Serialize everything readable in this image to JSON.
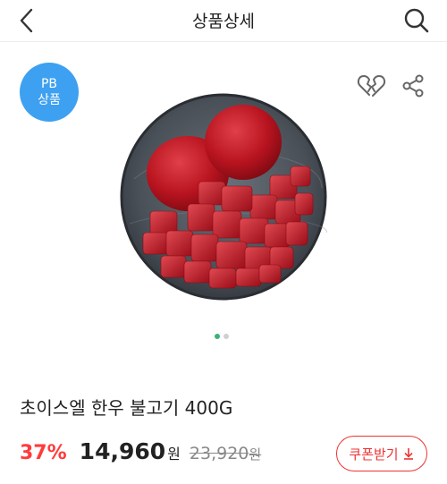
{
  "header": {
    "title": "상품상세",
    "back_icon": "chevron-left-icon",
    "search_icon": "search-icon"
  },
  "badge": {
    "line1": "PB",
    "line2": "상품",
    "color": "#3ea0f0"
  },
  "actions": {
    "like_icon": "heart-broken-icon",
    "share_icon": "share-icon"
  },
  "gallery": {
    "image_count": 2,
    "active_index": 1
  },
  "product": {
    "name": "초이스엘 한우 불고기 400G",
    "discount": "37%",
    "price": "14,960",
    "price_unit": "원",
    "original_price": "23,920",
    "original_unit": "원"
  },
  "coupon": {
    "label": "쿠폰받기",
    "icon": "download-icon",
    "color": "#ee3333"
  },
  "colors": {
    "discount": "#ff3b3b",
    "dot_active": "#3cb371"
  }
}
